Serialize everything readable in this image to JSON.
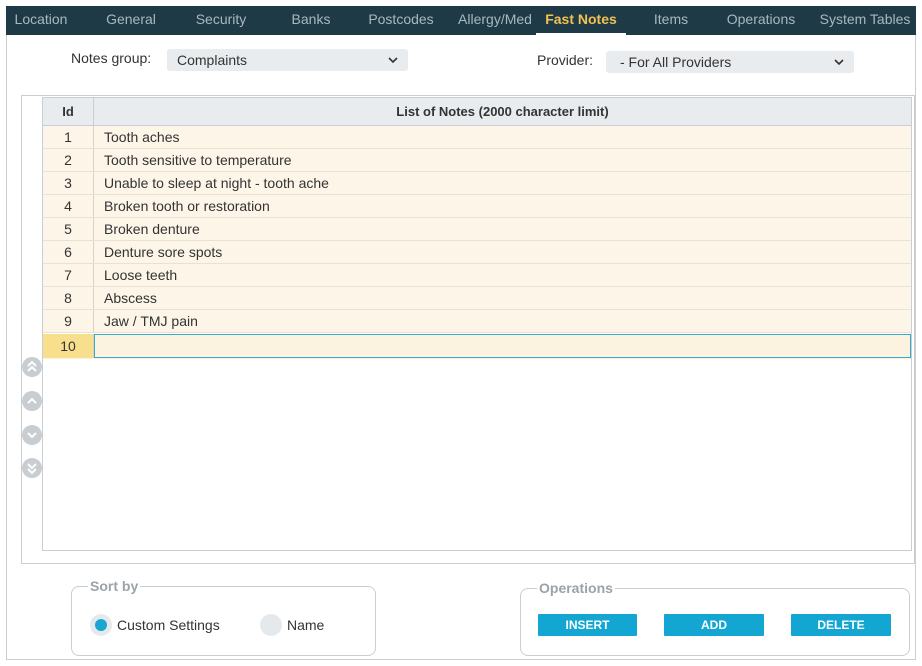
{
  "tabs": [
    {
      "label": "Location",
      "active": false
    },
    {
      "label": "General",
      "active": false
    },
    {
      "label": "Security",
      "active": false
    },
    {
      "label": "Banks",
      "active": false
    },
    {
      "label": "Postcodes",
      "active": false
    },
    {
      "label": "Allergy/Med",
      "active": false
    },
    {
      "label": "Fast Notes",
      "active": true
    },
    {
      "label": "Items",
      "active": false
    },
    {
      "label": "Operations",
      "active": false
    },
    {
      "label": "System Tables",
      "active": false
    }
  ],
  "filters": {
    "notes_group_label": "Notes group:",
    "notes_group_value": "Complaints",
    "provider_label": "Provider:",
    "provider_value": "- For All Providers"
  },
  "grid": {
    "columns": {
      "id": "Id",
      "note": "List of Notes (2000 character limit)"
    },
    "rows": [
      {
        "id": "1",
        "note": "Tooth aches"
      },
      {
        "id": "2",
        "note": "Tooth sensitive to temperature"
      },
      {
        "id": "3",
        "note": "Unable to sleep at night - tooth ache"
      },
      {
        "id": "4",
        "note": "Broken tooth or restoration"
      },
      {
        "id": "5",
        "note": "Broken denture"
      },
      {
        "id": "6",
        "note": "Denture sore spots"
      },
      {
        "id": "7",
        "note": "Loose teeth"
      },
      {
        "id": "8",
        "note": "Abscess"
      },
      {
        "id": "9",
        "note": "Jaw / TMJ pain"
      }
    ],
    "new_row": {
      "id": "10",
      "note": ""
    }
  },
  "nav_icons": [
    "move-top-icon",
    "move-up-icon",
    "move-down-icon",
    "move-bottom-icon"
  ],
  "sort": {
    "legend": "Sort by",
    "options": [
      {
        "label": "Custom Settings",
        "selected": true
      },
      {
        "label": "Name",
        "selected": false
      }
    ]
  },
  "operations": {
    "legend": "Operations",
    "insert_label": "INSERT",
    "add_label": "ADD",
    "delete_label": "DELETE"
  },
  "colors": {
    "tabbar_bg": "#1e3a47",
    "active_tab": "#f2c14e",
    "accent": "#14a6d3",
    "row_bg": "#fdf6e8",
    "new_row_id_bg": "#f8df8e"
  }
}
